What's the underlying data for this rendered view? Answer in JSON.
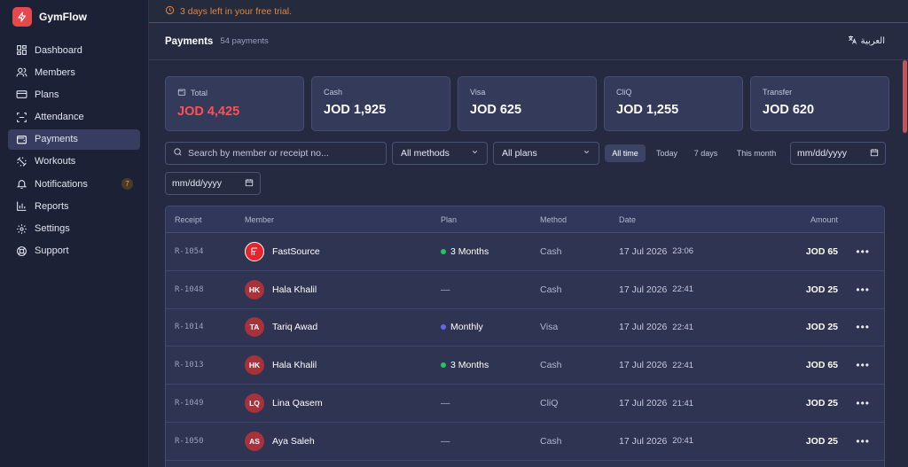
{
  "app": {
    "name": "GymFlow"
  },
  "sidebar": {
    "items": [
      {
        "label": "Dashboard",
        "icon": "dashboard-icon",
        "active": false
      },
      {
        "label": "Members",
        "icon": "users-icon",
        "active": false
      },
      {
        "label": "Plans",
        "icon": "card-icon",
        "active": false
      },
      {
        "label": "Attendance",
        "icon": "scan-icon",
        "active": false
      },
      {
        "label": "Payments",
        "icon": "wallet-icon",
        "active": true
      },
      {
        "label": "Workouts",
        "icon": "dumbbell-icon",
        "active": false
      },
      {
        "label": "Notifications",
        "icon": "bell-icon",
        "active": false,
        "badge": "7"
      },
      {
        "label": "Reports",
        "icon": "chart-icon",
        "active": false
      },
      {
        "label": "Settings",
        "icon": "gear-icon",
        "active": false
      },
      {
        "label": "Support",
        "icon": "lifebuoy-icon",
        "active": false
      }
    ]
  },
  "trial": {
    "text": "3 days left in your free trial."
  },
  "header": {
    "title": "Payments",
    "count": "54 payments",
    "language": "العربية"
  },
  "cards": [
    {
      "label": "Total",
      "value": "JOD 4,425"
    },
    {
      "label": "Cash",
      "value": "JOD 1,925"
    },
    {
      "label": "Visa",
      "value": "JOD 625"
    },
    {
      "label": "CliQ",
      "value": "JOD 1,255"
    },
    {
      "label": "Transfer",
      "value": "JOD 620"
    }
  ],
  "filters": {
    "search_placeholder": "Search by member or receipt no...",
    "method": "All methods",
    "plan": "All plans",
    "ranges": [
      "All time",
      "Today",
      "7 days",
      "This month"
    ],
    "active_range": "All time",
    "date_from": "mm/dd/yyyy",
    "date_to": "mm/dd/yyyy"
  },
  "table": {
    "columns": [
      "Receipt",
      "Member",
      "Plan",
      "Method",
      "Date",
      "Amount"
    ],
    "rows": [
      {
        "receipt": "R-1054",
        "initials": "",
        "member": "FastSource",
        "plan": "3 Months",
        "plan_color": "#22c55e",
        "method": "Cash",
        "date": "17 Jul 2026",
        "time": "23:06",
        "amount": "JOD 65"
      },
      {
        "receipt": "R-1048",
        "initials": "HK",
        "member": "Hala Khalil",
        "plan": "—",
        "plan_color": "",
        "method": "Cash",
        "date": "17 Jul 2026",
        "time": "22:41",
        "amount": "JOD 25"
      },
      {
        "receipt": "R-1014",
        "initials": "TA",
        "member": "Tariq Awad",
        "plan": "Monthly",
        "plan_color": "#6366f1",
        "method": "Visa",
        "date": "17 Jul 2026",
        "time": "22:41",
        "amount": "JOD 25"
      },
      {
        "receipt": "R-1013",
        "initials": "HK",
        "member": "Hala Khalil",
        "plan": "3 Months",
        "plan_color": "#22c55e",
        "method": "Cash",
        "date": "17 Jul 2026",
        "time": "22:41",
        "amount": "JOD 65"
      },
      {
        "receipt": "R-1049",
        "initials": "LQ",
        "member": "Lina Qasem",
        "plan": "—",
        "plan_color": "",
        "method": "CliQ",
        "date": "17 Jul 2026",
        "time": "21:41",
        "amount": "JOD 25"
      },
      {
        "receipt": "R-1050",
        "initials": "AS",
        "member": "Aya Saleh",
        "plan": "—",
        "plan_color": "",
        "method": "Cash",
        "date": "17 Jul 2026",
        "time": "20:41",
        "amount": "JOD 25"
      }
    ]
  },
  "colors": {
    "accent": "#e5484d",
    "total_value": "#ff5058",
    "warning": "#e0873a"
  }
}
